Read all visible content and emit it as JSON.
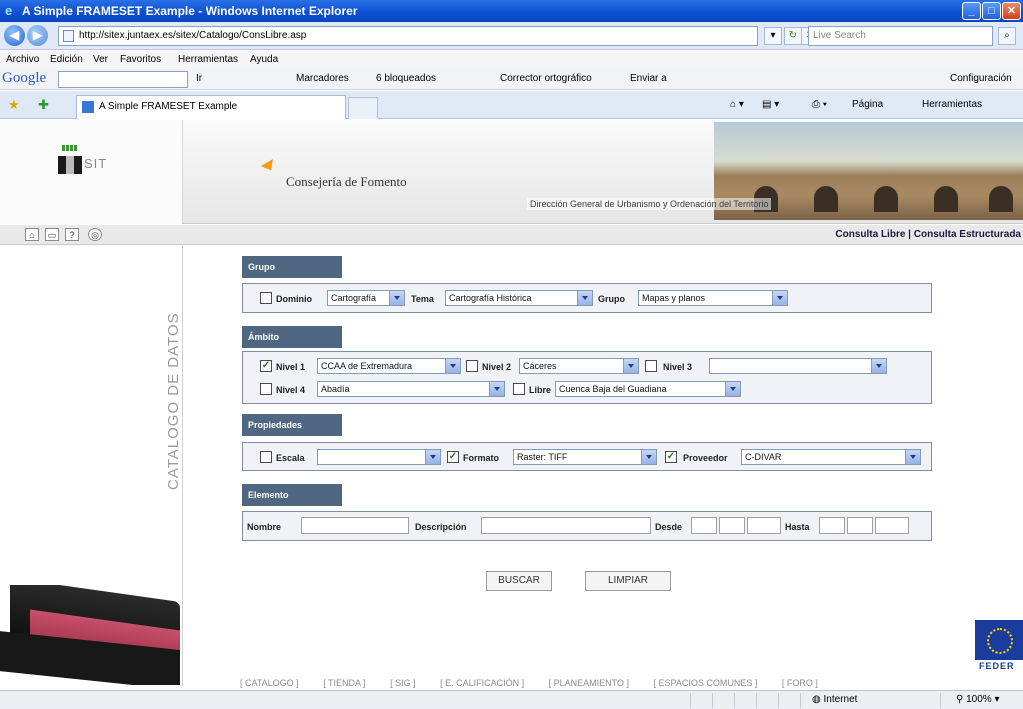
{
  "window": {
    "title": "A Simple FRAMESET Example - Windows Internet Explorer"
  },
  "address": {
    "url": "http://sitex.juntaex.es/sitex/Catalogo/ConsLibre.asp",
    "search_placeholder": "Live Search"
  },
  "menu": [
    "Archivo",
    "Edición",
    "Ver",
    "Favoritos",
    "Herramientas",
    "Ayuda"
  ],
  "google_toolbar": {
    "logo": "Google",
    "go": "Ir",
    "bookmarks": "Marcadores",
    "blocked": "6 bloqueados",
    "spell": "Corrector ortográfico",
    "send": "Enviar a",
    "settings": "Configuración"
  },
  "tab": {
    "title": "A Simple FRAMESET Example",
    "page": "Página",
    "tools": "Herramientas"
  },
  "banner": {
    "consejeria": "Consejería de Fomento",
    "direccion": "Dirección General de Urbanismo y Ordenación del Territorio",
    "consultas": "Consulta Libre | Consulta Estructurada"
  },
  "sidebar": {
    "label": "CATALOGO DE DATOS"
  },
  "grupo": {
    "header": "Grupo",
    "dominio_label": "Dominio",
    "dominio_value": "Cartografía",
    "tema_label": "Tema",
    "tema_value": "Cartografía Histórica",
    "grupo_label": "Grupo",
    "grupo_value": "Mapas y planos"
  },
  "ambito": {
    "header": "Ámbito",
    "nivel1_label": "Nivel 1",
    "nivel1_value": "CCAA de Extremadura",
    "nivel1_checked": true,
    "nivel2_label": "Nivel 2",
    "nivel2_value": "Cáceres",
    "nivel3_label": "Nivel 3",
    "nivel3_value": "",
    "nivel4_label": "Nivel 4",
    "nivel4_value": "Abadía",
    "libre_label": "Libre",
    "libre_value": "Cuenca Baja del Guadiana"
  },
  "propiedades": {
    "header": "Propiedades",
    "escala_label": "Escala",
    "escala_value": "",
    "formato_label": "Formato",
    "formato_value": "Raster: TIFF",
    "formato_checked": true,
    "proveedor_label": "Proveedor",
    "proveedor_value": "C-DIVAR",
    "proveedor_checked": true
  },
  "elemento": {
    "header": "Elemento",
    "nombre_label": "Nombre",
    "descripcion_label": "Descripción",
    "desde_label": "Desde",
    "hasta_label": "Hasta"
  },
  "buttons": {
    "buscar": "BUSCAR",
    "limpiar": "LIMPIAR"
  },
  "feder": "FEDER",
  "footer_links": [
    "[ CATALOGO ]",
    "[ TIENDA ]",
    "[ SIG ]",
    "[ E. CALIFICACIÓN ]",
    "[ PLANEAMIENTO ]",
    "[ ESPACIOS COMUNES ]",
    "[ FORO ]"
  ],
  "status": {
    "zone": "Internet",
    "zoom": "100%"
  }
}
